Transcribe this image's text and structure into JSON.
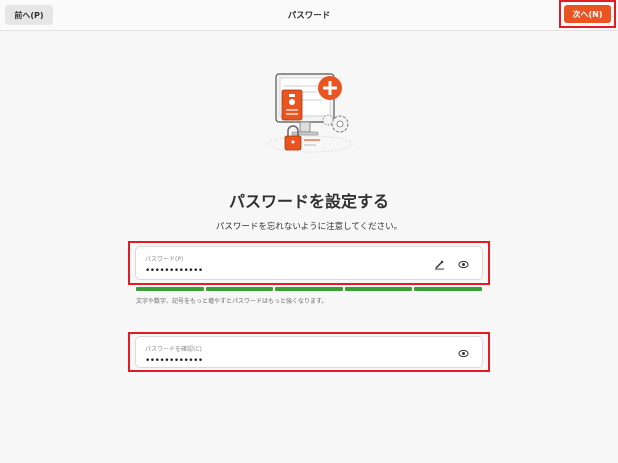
{
  "header": {
    "back_label": "前へ(P)",
    "title": "パスワード",
    "next_label": "次へ(N)"
  },
  "main": {
    "heading": "パスワードを設定する",
    "description": "パスワードを忘れないように注意してください。",
    "password": {
      "label": "パスワード(P)",
      "value": "••••••••••••",
      "strength_segments": 5,
      "strength_color": "#3a9e35"
    },
    "hint": "文字や数字、記号をもっと増やすとパスワードはもっと強くなります。",
    "confirm": {
      "label": "パスワードを確認(C)",
      "value": "••••••••••••"
    }
  },
  "colors": {
    "accent": "#e95420",
    "highlight": "#e31b23"
  },
  "icons": {
    "generate": "wand-icon",
    "reveal": "eye-icon",
    "reveal_confirm": "eye-icon"
  }
}
